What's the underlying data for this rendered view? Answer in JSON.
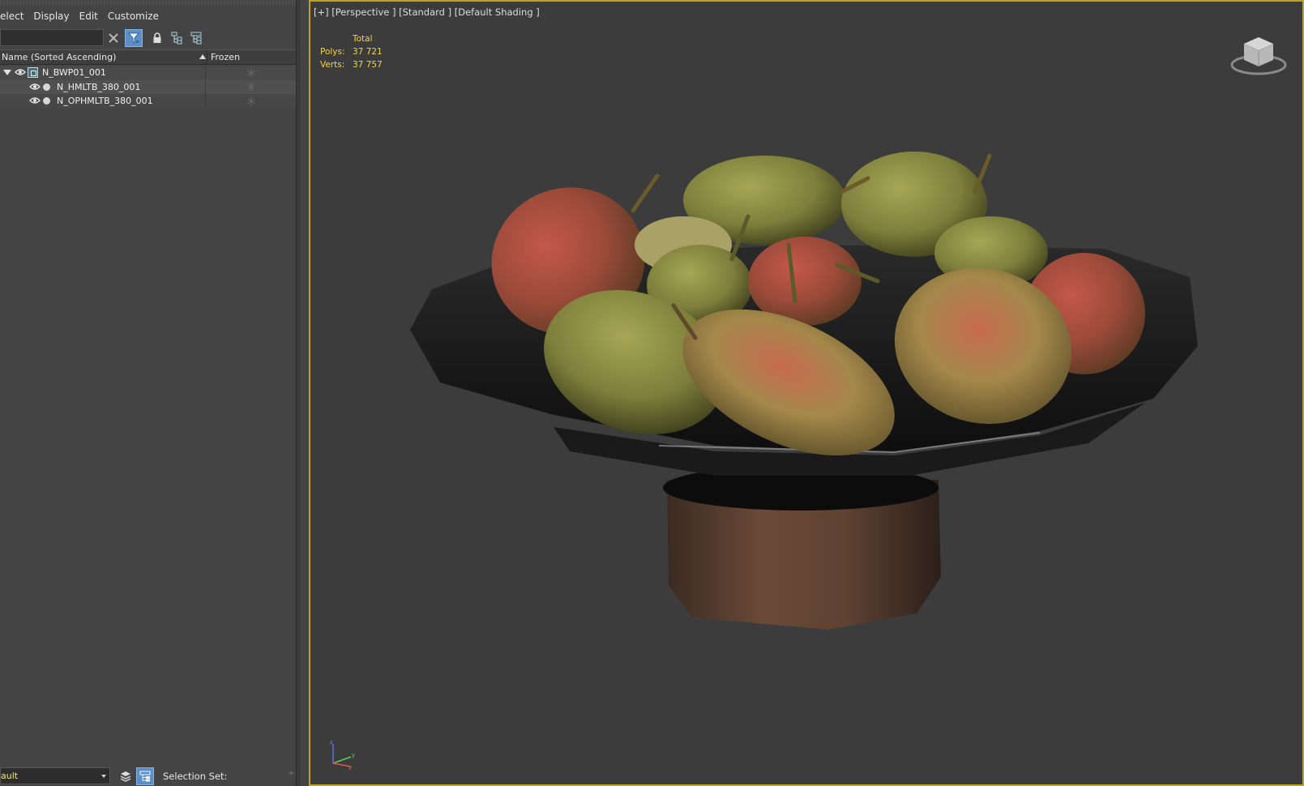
{
  "explorer": {
    "menu": [
      "elect",
      "Display",
      "Edit",
      "Customize"
    ],
    "search": {
      "value": "",
      "placeholder": ""
    },
    "columns": {
      "name": "Name (Sorted Ascending)",
      "frozen": "Frozen"
    },
    "tree": [
      {
        "label": "N_BWP01_001",
        "level": 0,
        "expanded": true,
        "type": "group"
      },
      {
        "label": "N_HMLTB_380_001",
        "level": 1,
        "type": "object"
      },
      {
        "label": "N_OPHMLTB_380_001",
        "level": 1,
        "type": "object"
      }
    ],
    "bottom": {
      "layer_value": "ault",
      "selection_set_label": "Selection Set:"
    },
    "icons": {
      "clear": "close-icon",
      "filter": "filter-icon",
      "lock": "lock-icon",
      "hierarchy": "hierarchy-icon",
      "eye": "eye-icon",
      "frozen": "snowflake-icon",
      "layers": "layers-icon"
    }
  },
  "viewport": {
    "label": "[+] [Perspective ] [Standard ] [Default Shading ]",
    "stats": {
      "header": "Total",
      "polys_label": "Polys:",
      "polys": "37 721",
      "verts_label": "Verts:",
      "verts": "37 757"
    },
    "colors": {
      "active_border": "#bfa21e",
      "stats_text": "#f2d34a",
      "background": "#3c3c3c"
    }
  }
}
